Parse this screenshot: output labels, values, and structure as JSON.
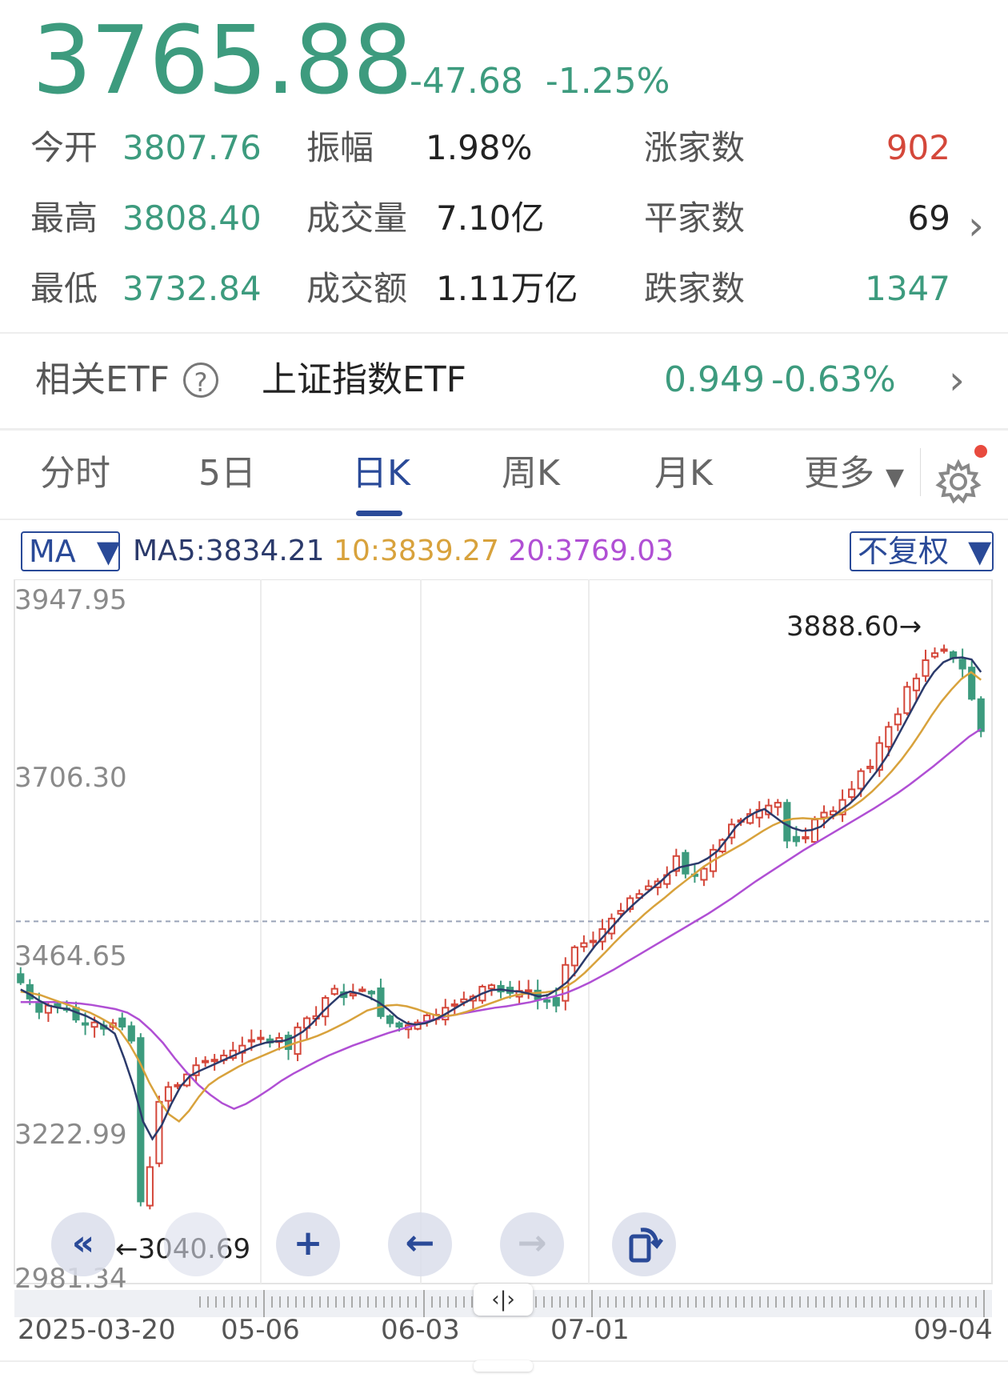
{
  "quote": {
    "price": "3765.88",
    "change": "-47.68",
    "change_pct": "-1.25%"
  },
  "stats": {
    "open_label": "今开",
    "open": "3807.76",
    "high_label": "最高",
    "high": "3808.40",
    "low_label": "最低",
    "low": "3732.84",
    "amplitude_label": "振幅",
    "amplitude": "1.98%",
    "volume_label": "成交量",
    "volume": "7.10亿",
    "turnover_label": "成交额",
    "turnover": "1.11万亿",
    "up_label": "涨家数",
    "up": "902",
    "flat_label": "平家数",
    "flat": "69",
    "down_label": "跌家数",
    "down": "1347"
  },
  "etf": {
    "label": "相关ETF",
    "help_icon": "?",
    "name": "上证指数ETF",
    "price": "0.949",
    "change_pct": "-0.63%"
  },
  "tabs": [
    "分时",
    "5日",
    "日K",
    "周K",
    "月K",
    "更多"
  ],
  "active_tab": "日K",
  "chart_header": {
    "indicator": "MA",
    "ma5": "MA5:3834.21",
    "ma10": "10:3839.27",
    "ma20": "20:3769.03",
    "adjust": "不复权"
  },
  "colors": {
    "up": "#d4473a",
    "down": "#3d9b7e",
    "ma5": "#2b3a6b",
    "ma10": "#d8a23c",
    "ma20": "#b04fd4",
    "accent": "#2a4a98"
  },
  "icons": {
    "settings": "gear-icon",
    "notification": "red-dot-badge"
  },
  "chart_data": {
    "type": "candlestick",
    "y_ticks": [
      "3947.95",
      "3706.30",
      "3464.65",
      "3222.99",
      "2981.34"
    ],
    "x_ticks": [
      "2025-03-20",
      "05-06",
      "06-03",
      "07-01",
      "09-04"
    ],
    "ylim": [
      2981.34,
      3947.95
    ],
    "annotations": {
      "high": "3888.60",
      "low": "3040.69"
    },
    "reference_line": 3495,
    "close": [
      3408,
      3385,
      3366,
      3375,
      3373,
      3371,
      3355,
      3350,
      3351,
      3342,
      3350,
      3345,
      3325,
      3096,
      3145,
      3238,
      3259,
      3262,
      3277,
      3290,
      3296,
      3298,
      3304,
      3311,
      3318,
      3326,
      3329,
      3327,
      3329,
      3313,
      3344,
      3357,
      3360,
      3386,
      3399,
      3387,
      3392,
      3398,
      3395,
      3360,
      3350,
      3345,
      3347,
      3351,
      3361,
      3362,
      3372,
      3377,
      3384,
      3388,
      3402,
      3404,
      3395,
      3393,
      3396,
      3397,
      3384,
      3382,
      3375,
      3433,
      3458,
      3464,
      3467,
      3484,
      3499,
      3510,
      3528,
      3534,
      3545,
      3552,
      3561,
      3588,
      3563,
      3560,
      3570,
      3597,
      3611,
      3633,
      3639,
      3648,
      3654,
      3660,
      3664,
      3610,
      3609,
      3614,
      3640,
      3650,
      3652,
      3668,
      3683,
      3709,
      3713,
      3749,
      3772,
      3790,
      3829,
      3841,
      3867,
      3877,
      3882,
      3870,
      3855,
      3812,
      3766
    ],
    "ma5": [
      3398,
      3391,
      3382,
      3375,
      3372,
      3370,
      3365,
      3360,
      3353,
      3345,
      3335,
      3300,
      3260,
      3210,
      3185,
      3205,
      3235,
      3260,
      3275,
      3282,
      3288,
      3294,
      3300,
      3306,
      3312,
      3318,
      3322,
      3324,
      3325,
      3330,
      3338,
      3350,
      3365,
      3378,
      3390,
      3395,
      3392,
      3387,
      3380,
      3370,
      3358,
      3350,
      3348,
      3350,
      3355,
      3362,
      3370,
      3378,
      3385,
      3392,
      3397,
      3398,
      3396,
      3395,
      3392,
      3388,
      3390,
      3398,
      3408,
      3423,
      3442,
      3460,
      3475,
      3490,
      3505,
      3518,
      3530,
      3541,
      3552,
      3565,
      3572,
      3575,
      3578,
      3585,
      3595,
      3612,
      3630,
      3642,
      3650,
      3655,
      3645,
      3635,
      3628,
      3624,
      3625,
      3630,
      3642,
      3652,
      3662,
      3675,
      3693,
      3710,
      3730,
      3755,
      3780,
      3805,
      3830,
      3850,
      3864,
      3870,
      3871,
      3868,
      3850
    ],
    "ma10": [
      3395,
      3393,
      3390,
      3385,
      3380,
      3375,
      3370,
      3365,
      3358,
      3350,
      3340,
      3320,
      3295,
      3265,
      3240,
      3220,
      3210,
      3225,
      3245,
      3262,
      3272,
      3280,
      3288,
      3295,
      3301,
      3307,
      3313,
      3318,
      3323,
      3327,
      3332,
      3338,
      3345,
      3352,
      3360,
      3368,
      3372,
      3375,
      3376,
      3374,
      3370,
      3365,
      3361,
      3360,
      3362,
      3366,
      3371,
      3376,
      3381,
      3386,
      3390,
      3392,
      3393,
      3394,
      3396,
      3401,
      3410,
      3422,
      3436,
      3450,
      3465,
      3479,
      3492,
      3505,
      3517,
      3528,
      3540,
      3551,
      3562,
      3573,
      3582,
      3590,
      3598,
      3606,
      3615,
      3624,
      3632,
      3638,
      3641,
      3642,
      3641,
      3641,
      3644,
      3650,
      3658,
      3668,
      3680,
      3694,
      3709,
      3726,
      3745,
      3766,
      3788,
      3808,
      3825,
      3840,
      3850,
      3839
    ],
    "ma20": [
      3380,
      3380,
      3380,
      3380,
      3379,
      3378,
      3376,
      3373,
      3370,
      3365,
      3355,
      3340,
      3322,
      3300,
      3280,
      3262,
      3248,
      3236,
      3228,
      3235,
      3245,
      3256,
      3268,
      3278,
      3287,
      3296,
      3304,
      3311,
      3318,
      3324,
      3330,
      3336,
      3341,
      3346,
      3351,
      3356,
      3360,
      3363,
      3366,
      3369,
      3372,
      3374,
      3377,
      3380,
      3384,
      3388,
      3393,
      3400,
      3408,
      3417,
      3426,
      3436,
      3446,
      3456,
      3466,
      3476,
      3486,
      3496,
      3506,
      3517,
      3528,
      3540,
      3552,
      3563,
      3574,
      3585,
      3596,
      3606,
      3616,
      3626,
      3636,
      3646,
      3656,
      3667,
      3678,
      3690,
      3703,
      3716,
      3730,
      3744,
      3758,
      3769
    ]
  },
  "controls": [
    "first-page",
    "zoom-in",
    "pan-left",
    "pan-right",
    "rotate"
  ]
}
